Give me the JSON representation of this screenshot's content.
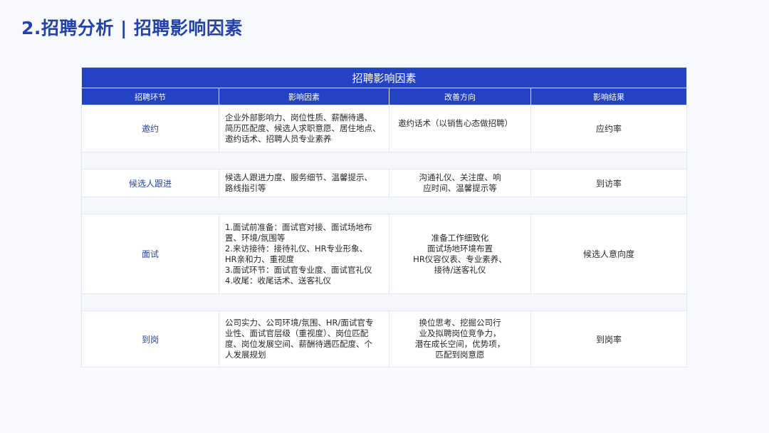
{
  "page_title": "2.招聘分析 | 招聘影响因素",
  "table": {
    "caption": "招聘影响因素",
    "headers": [
      "招聘环节",
      "影响因素",
      "改善方向",
      "影响结果"
    ],
    "rows": [
      {
        "stage": "邀约",
        "factors": [
          "企业外部影响力、岗位性质、薪酬待遇、",
          "简历匹配度、候选人求职意愿、居住地点、",
          "邀约话术、招聘人员专业素养"
        ],
        "directions": [
          "邀约话术（以销售心态做招聘）"
        ],
        "result": "应约率"
      },
      {
        "stage": "候选人跟进",
        "factors": [
          "候选人跟进力度、服务细节、温馨提示、",
          "路线指引等"
        ],
        "directions": [
          "沟通礼仪、关注度、响",
          "应时间、温馨提示等"
        ],
        "result": "到访率"
      },
      {
        "stage": "面试",
        "factors": [
          "1.面试前准备：面试官对接、面试场地布",
          "置、环境/氛围等",
          "2.来访接待：接待礼仪、HR专业形象、",
          "HR亲和力、重视度",
          "3.面试环节：面试官专业度、面试官礼仪",
          "4.收尾：收尾话术、送客礼仪"
        ],
        "directions": [
          "准备工作细致化",
          "面试场地环境布置",
          "HR仪容仪表、专业素养、",
          "接待/送客礼仪"
        ],
        "result": "候选人意向度"
      },
      {
        "stage": "到岗",
        "factors": [
          "公司实力、公司环境/氛围、HR/面试官专",
          "业性、面试官层级（重视度）、岗位匹配",
          "度、岗位发展空间、薪酬待遇匹配度、个",
          "人发展规划"
        ],
        "directions": [
          "换位思考、挖掘公司行",
          "业及拟聘岗位竞争力，",
          "潜在成长空间，优势项，",
          "匹配到岗意愿"
        ],
        "result": "到岗率"
      }
    ]
  }
}
